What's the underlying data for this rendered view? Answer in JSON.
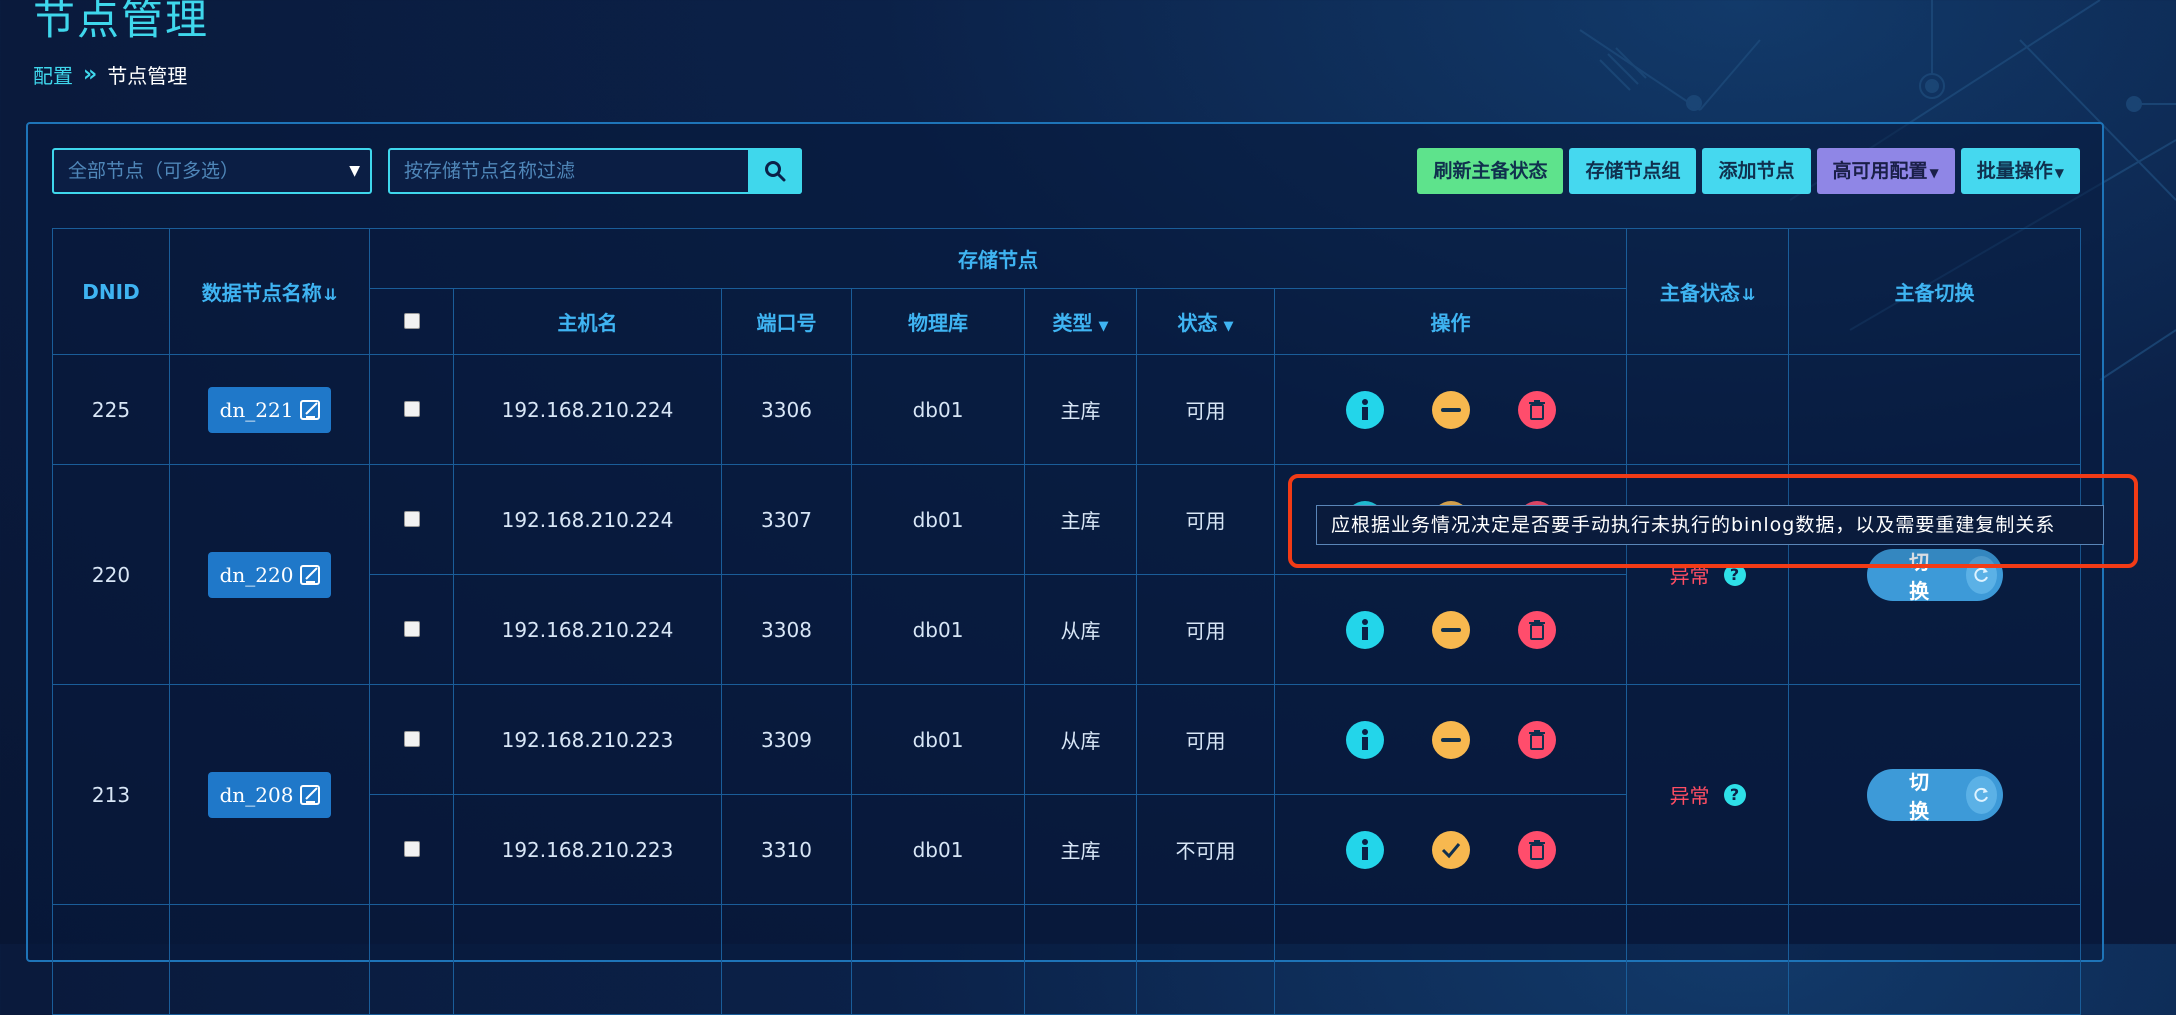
{
  "page": {
    "title": "节点管理"
  },
  "breadcrumb": {
    "root": "配置",
    "separator": "»",
    "current": "节点管理"
  },
  "filters": {
    "node_select_label": "全部节点（可多选）",
    "search_placeholder": "按存储节点名称过滤"
  },
  "toolbar": {
    "refresh_label": "刷新主备状态",
    "group_label": "存储节点组",
    "add_label": "添加节点",
    "ha_label": "高可用配置",
    "batch_label": "批量操作",
    "colors": {
      "green": "#5ee38c",
      "cyan": "#45d8ef",
      "purple": "#8f86e6"
    }
  },
  "table": {
    "headers": {
      "dnid": "DNID",
      "name": "数据节点名称",
      "storage_group": "存储节点",
      "host": "主机名",
      "port": "端口号",
      "db": "物理库",
      "type": "类型",
      "status": "状态",
      "ops": "操作",
      "ms_state": "主备状态",
      "ms_switch": "主备切换"
    },
    "groups": [
      {
        "dnid": "225",
        "name": "dn_221",
        "ms_state": "",
        "switch_label": "",
        "rows": [
          {
            "host": "192.168.210.224",
            "port": "3306",
            "db": "db01",
            "type": "主库",
            "status": "可用"
          }
        ]
      },
      {
        "dnid": "220",
        "name": "dn_220",
        "ms_state": "异常",
        "switch_label": "切 换",
        "rows": [
          {
            "host": "192.168.210.224",
            "port": "3307",
            "db": "db01",
            "type": "主库",
            "status": "可用"
          },
          {
            "host": "192.168.210.224",
            "port": "3308",
            "db": "db01",
            "type": "从库",
            "status": "可用"
          }
        ]
      },
      {
        "dnid": "213",
        "name": "dn_208",
        "ms_state": "异常",
        "switch_label": "切 换",
        "rows": [
          {
            "host": "192.168.210.223",
            "port": "3309",
            "db": "db01",
            "type": "从库",
            "status": "可用"
          },
          {
            "host": "192.168.210.223",
            "port": "3310",
            "db": "db01",
            "type": "主库",
            "status": "不可用"
          }
        ]
      }
    ]
  },
  "tooltip": {
    "text": "应根据业务情况决定是否要手动执行未执行的binlog数据，以及需要重建复制关系",
    "highlight_color": "#f23b16"
  },
  "icons": [
    "search-icon",
    "caret-down-icon",
    "edit-icon",
    "sort-icon",
    "info-icon",
    "minus-icon",
    "check-icon",
    "trash-icon",
    "question-icon",
    "refresh-icon"
  ],
  "colors": {
    "accent": "#3fd7ec",
    "ok": "#3ee38b",
    "error": "#ff4d63",
    "warning": "#f7b84f"
  }
}
